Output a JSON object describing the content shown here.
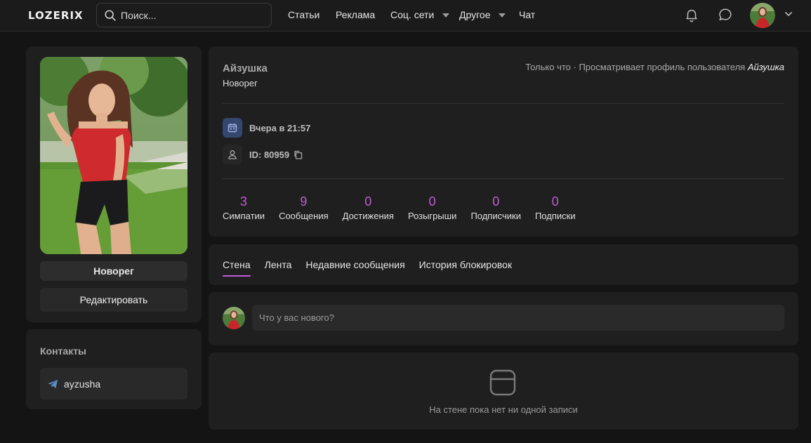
{
  "header": {
    "logo": "LOZERIX",
    "search_placeholder": "Поиск...",
    "nav": [
      {
        "label": "Статьи"
      },
      {
        "label": "Реклама"
      },
      {
        "label": "Соц. сети"
      },
      {
        "label": "Другое"
      },
      {
        "label": "Чат"
      }
    ]
  },
  "profile": {
    "rank_button": "Новорег",
    "edit_button": "Редактировать"
  },
  "contacts": {
    "title": "Контакты",
    "telegram": "ayzusha"
  },
  "user": {
    "name": "Айзушка",
    "rank": "Новорег",
    "status_prefix": "Только что · Просматривает профиль пользователя",
    "status_user": "Айзушка",
    "registered": "Вчера в 21:57",
    "id": "ID: 80959"
  },
  "stats": [
    {
      "value": "3",
      "label": "Симпатии"
    },
    {
      "value": "9",
      "label": "Сообщения"
    },
    {
      "value": "0",
      "label": "Достижения"
    },
    {
      "value": "0",
      "label": "Розыгрыши"
    },
    {
      "value": "0",
      "label": "Подписчики"
    },
    {
      "value": "0",
      "label": "Подписки"
    }
  ],
  "tabs": [
    {
      "label": "Стена"
    },
    {
      "label": "Лента"
    },
    {
      "label": "Недавние сообщения"
    },
    {
      "label": "История блокировок"
    }
  ],
  "wall": {
    "placeholder": "Что у вас нового?",
    "empty": "На стене пока нет ни одной записи"
  },
  "colors": {
    "accent": "#c25bd6",
    "background": "#141414",
    "card": "#1f1f1f"
  }
}
